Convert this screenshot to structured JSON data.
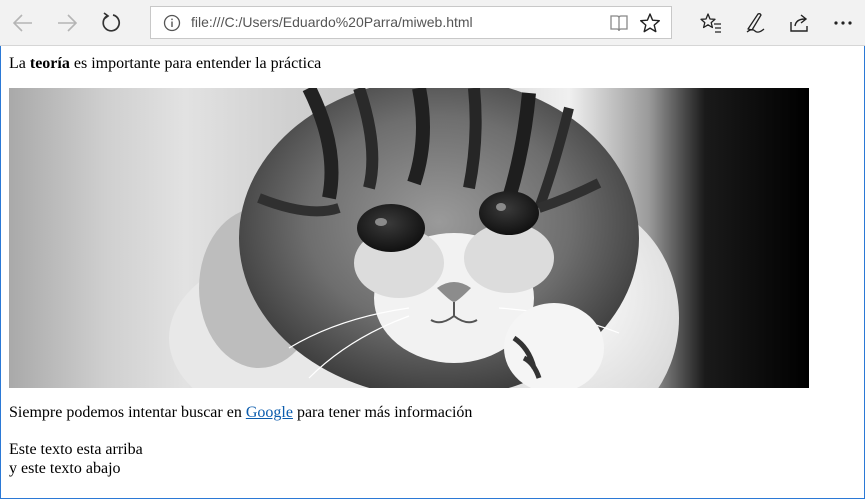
{
  "browser": {
    "url": "file:///C:/Users/Eduardo%20Parra/miweb.html",
    "icons": {
      "back": "arrow-left-icon",
      "forward": "arrow-right-icon",
      "refresh": "refresh-icon",
      "site_info": "info-icon",
      "reading_view": "book-icon",
      "add_favorite": "star-icon",
      "favorites": "favorites-list-icon",
      "notes": "pen-icon",
      "share": "share-icon",
      "more": "more-dots-icon"
    }
  },
  "content": {
    "para1": {
      "before": "La ",
      "bold": "teoría",
      "after": " es importante para entender la práctica"
    },
    "image": {
      "subject": "black-and-white kitten photo"
    },
    "para2": {
      "before": "Siempre podemos intentar buscar en ",
      "link": "Google",
      "after": " para tener más información"
    },
    "para3": {
      "line1": "Este texto esta arriba",
      "line2": "y este texto abajo"
    }
  },
  "colors": {
    "link": "#0b5cad",
    "page_border": "#2b79d6",
    "toolbar_bg": "#f2f2f2"
  }
}
